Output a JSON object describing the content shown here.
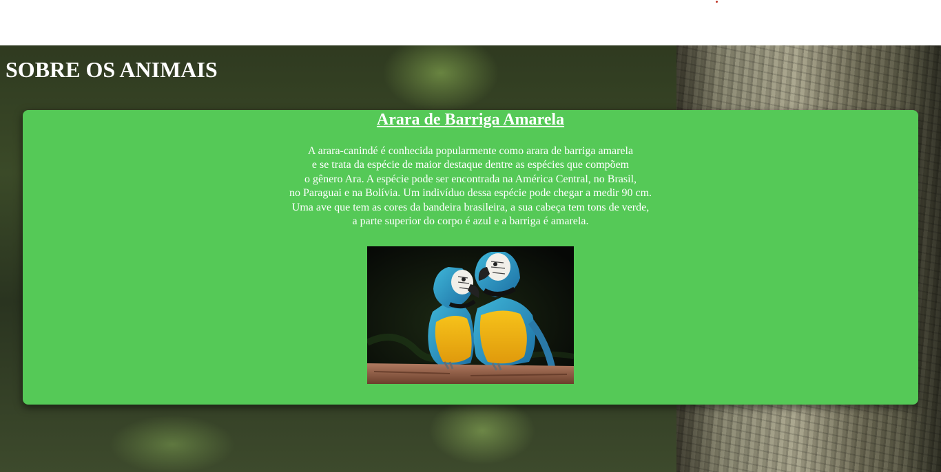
{
  "page": {
    "title": "SOBRE OS ANIMAIS"
  },
  "card": {
    "title": "Arara de Barriga Amarela",
    "lines": [
      "A arara-canindé é conhecida popularmente como arara de barriga amarela",
      "e se trata da espécie de maior destaque dentre as espécies que compõem",
      "o gênero Ara. A espécie pode ser encontrada na América Central, no Brasil,",
      "no Paraguai e na Bolívia. Um indivíduo dessa espécie pode chegar a medir 90 cm.",
      "Uma ave que tem as cores da bandeira brasileira, a sua cabeça tem tons de verde,",
      "a parte superior do corpo é azul e a barriga é amarela."
    ],
    "image_icon": "macaw-pair-photo"
  },
  "colors": {
    "card_bg": "#55c957",
    "text": "#ffffff",
    "accent_dot": "#c0392b"
  }
}
